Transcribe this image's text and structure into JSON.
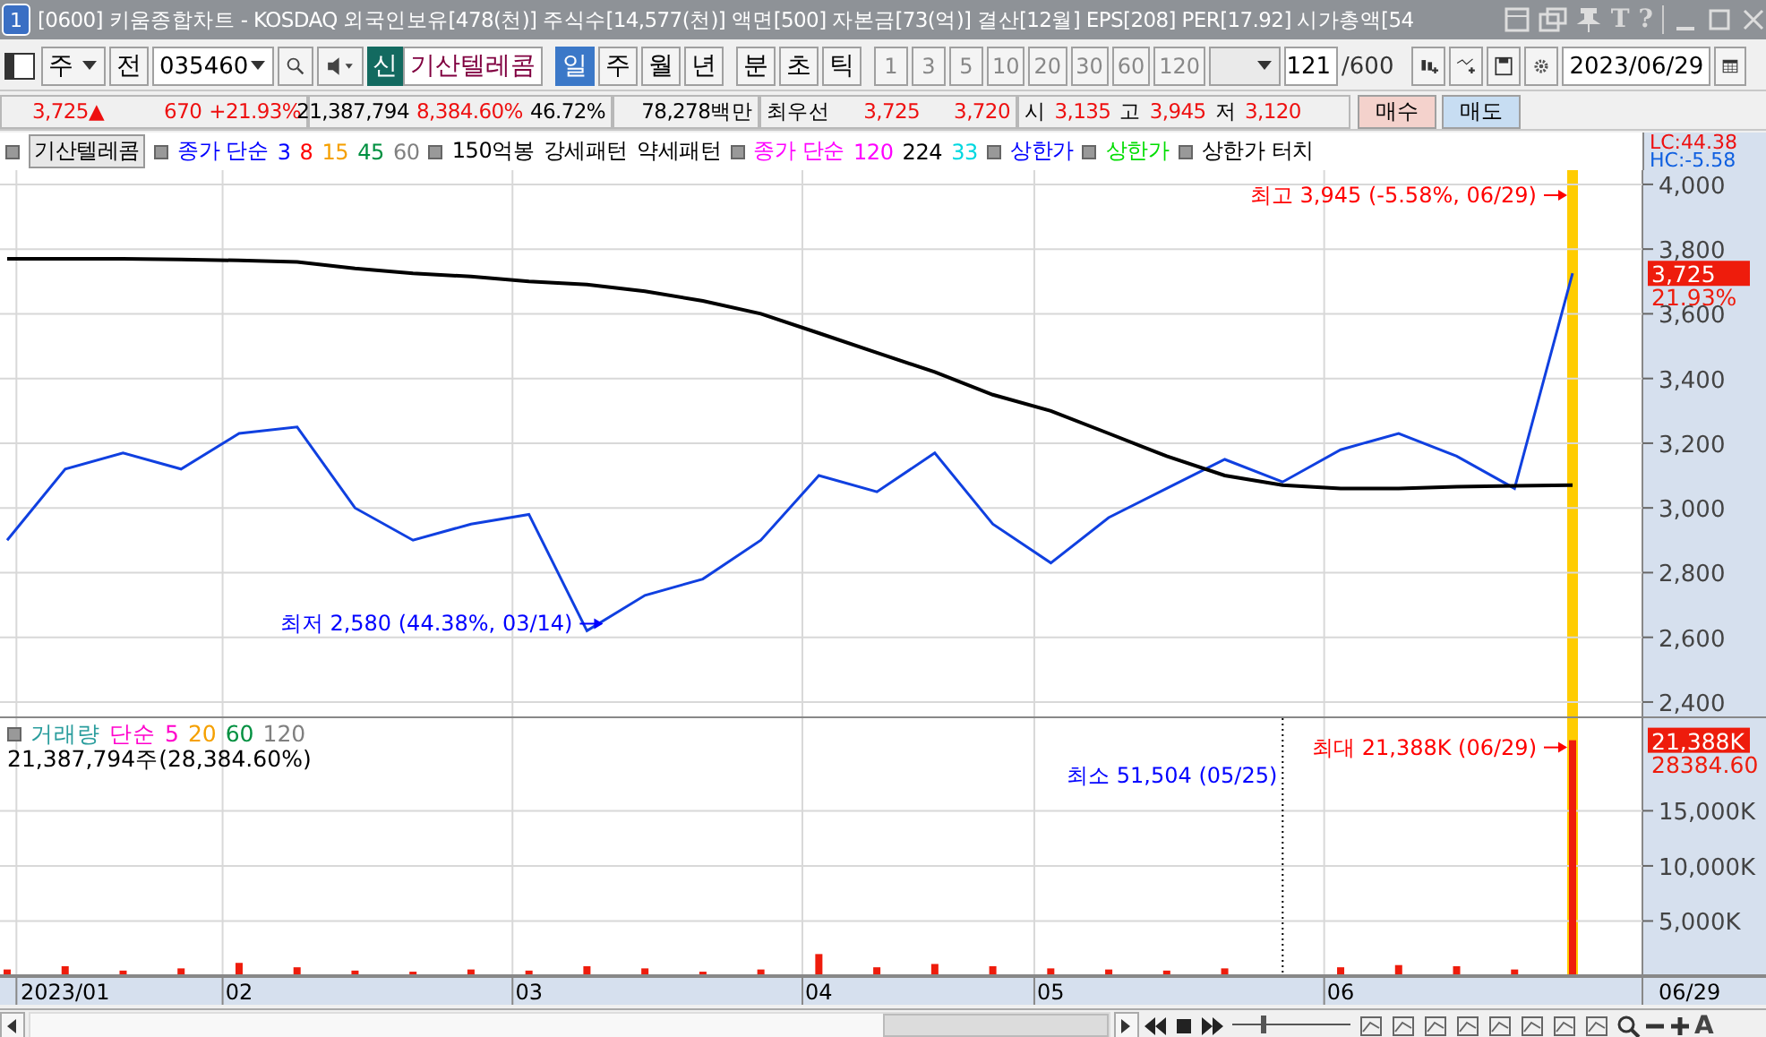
{
  "window": {
    "badge": "1",
    "title": "[0600] 키움종합차트 - KOSDAQ 외국인보유[478(천)] 주식수[14,577(천)] 액면[500] 자본금[73(억)] 결산[12월] EPS[208] PER[17.92] 시가총액[54",
    "glyph_buttons": [
      "T",
      "?"
    ]
  },
  "toolbar": {
    "market": "주",
    "prev_button": "전",
    "code": "035460",
    "new_button": "신",
    "stock_name": "기산텔레콤",
    "periods": [
      {
        "label": "일",
        "selected": true
      },
      {
        "label": "주",
        "selected": false
      },
      {
        "label": "월",
        "selected": false
      },
      {
        "label": "년",
        "selected": false
      }
    ],
    "intervals": [
      {
        "label": "분",
        "selected": false
      },
      {
        "label": "초",
        "selected": false
      },
      {
        "label": "틱",
        "selected": false
      }
    ],
    "interval_values": [
      "1",
      "3",
      "5",
      "10",
      "20",
      "30",
      "60",
      "120"
    ],
    "count": "121",
    "count_max": "/600",
    "date": "2023/06/29"
  },
  "quote": {
    "price": "3,725",
    "arrow": "▲",
    "change": "670",
    "change_rate": "+21.93%",
    "volume": "21,387,794",
    "volume_rate": "8,384.60%",
    "ratio": "46.72%",
    "amount": "78,278백만",
    "best_label": "최우선",
    "best_ask": "3,725",
    "best_bid": "3,720",
    "open_label": "시",
    "open": "3,135",
    "high_label": "고",
    "high": "3,945",
    "low_label": "저",
    "low": "3,120",
    "buy_button": "매수",
    "sell_button": "매도"
  },
  "legend": [
    {
      "kind": "marker"
    },
    {
      "kind": "title",
      "text": "기산텔레콤"
    },
    {
      "kind": "marker"
    },
    {
      "kind": "label",
      "text": "종가 단순",
      "color": "#0000ff"
    },
    {
      "kind": "label",
      "text": "3",
      "color": "#0000ff"
    },
    {
      "kind": "label",
      "text": "8",
      "color": "#ff0000"
    },
    {
      "kind": "label",
      "text": "15",
      "color": "#f5a000"
    },
    {
      "kind": "label",
      "text": "45",
      "color": "#009040"
    },
    {
      "kind": "label",
      "text": "60",
      "color": "#808080"
    },
    {
      "kind": "marker"
    },
    {
      "kind": "label",
      "text": "150억봉",
      "color": "#000000"
    },
    {
      "kind": "label",
      "text": "강세패턴",
      "color": "#000000"
    },
    {
      "kind": "label",
      "text": "약세패턴",
      "color": "#000000"
    },
    {
      "kind": "marker"
    },
    {
      "kind": "label",
      "text": "종가 단순",
      "color": "#ff00ff"
    },
    {
      "kind": "label",
      "text": "120",
      "color": "#ff00ff"
    },
    {
      "kind": "label",
      "text": "224",
      "color": "#000000"
    },
    {
      "kind": "label",
      "text": "33",
      "color": "#00d8e0"
    },
    {
      "kind": "marker"
    },
    {
      "kind": "label",
      "text": "상한가",
      "color": "#0000ff"
    },
    {
      "kind": "marker"
    },
    {
      "kind": "label",
      "text": "상한가",
      "color": "#00dd00"
    },
    {
      "kind": "marker"
    },
    {
      "kind": "label",
      "text": "상한가 터치",
      "color": "#000000"
    }
  ],
  "price_axis_stats": {
    "lc": "LC:44.38",
    "hc": "HC:-5.58"
  },
  "price_tag": {
    "label": "3,725",
    "sublabel": "21.93%"
  },
  "price_chart": {
    "chart_data": {
      "type": "line",
      "categories": [
        null,
        null,
        null,
        null,
        null,
        null,
        null,
        null,
        null,
        null,
        null,
        null,
        null,
        null,
        null,
        null,
        null,
        null,
        null,
        null,
        null,
        null,
        null,
        null,
        null,
        null,
        null,
        null
      ],
      "series": [
        {
          "color": "#1040e0",
          "values": [
            2900,
            3120,
            3170,
            3120,
            3230,
            3250,
            3000,
            2900,
            2950,
            2980,
            2620,
            2730,
            2780,
            2900,
            3100,
            3050,
            3170,
            2950,
            2830,
            2970,
            3060,
            3150,
            3080,
            3180,
            3230,
            3160,
            3060,
            3725
          ]
        },
        {
          "color": "#000000",
          "values": [
            3770,
            3770,
            3770,
            3768,
            3765,
            3760,
            3740,
            3725,
            3715,
            3700,
            3690,
            3670,
            3640,
            3600,
            3540,
            3480,
            3420,
            3350,
            3300,
            3230,
            3160,
            3100,
            3070,
            3060,
            3060,
            3065,
            3068,
            3070
          ]
        }
      ],
      "ylim": [
        2350,
        4044
      ],
      "grid": true,
      "yticks": [
        {
          "value": 2400,
          "label": "2,400"
        },
        {
          "value": 2600,
          "label": "2,600"
        },
        {
          "value": 2800,
          "label": "2,800"
        },
        {
          "value": 3000,
          "label": "3,000"
        },
        {
          "value": 3200,
          "label": "3,200"
        },
        {
          "value": 3400,
          "label": "3,400"
        },
        {
          "value": 3600,
          "label": "3,600"
        },
        {
          "value": 3800,
          "label": "3,800"
        },
        {
          "value": 4000,
          "label": "4,000"
        }
      ],
      "annotations": [
        "최고 3,945 (-5.58%, 06/29)",
        "최저 2,580 (44.38%, 03/14)"
      ]
    }
  },
  "volume_legend": {
    "parts": [
      {
        "text": "거래량",
        "color": "#2a9d9d"
      },
      {
        "text": "단순",
        "color": "#ff00cc"
      },
      {
        "text": "5",
        "color": "#ff00cc"
      },
      {
        "text": "20",
        "color": "#f5a000"
      },
      {
        "text": "60",
        "color": "#009040"
      },
      {
        "text": "120",
        "color": "#808080"
      }
    ],
    "summary": "21,387,794주(28,384.60%)"
  },
  "volume_tag": {
    "label": "21,388K",
    "sublabel": "28384.60"
  },
  "volume_chart": {
    "chart_data": {
      "type": "bar",
      "categories": [
        null,
        "2023/01",
        null,
        null,
        "02",
        null,
        null,
        null,
        null,
        "03",
        null,
        null,
        null,
        null,
        "04",
        null,
        null,
        null,
        "05",
        null,
        null,
        null,
        null,
        "06",
        null,
        null,
        null,
        null
      ],
      "series": [
        {
          "color": "#ee1c0c",
          "values": [
            600,
            900,
            500,
            700,
            1200,
            800,
            500,
            400,
            600,
            500,
            900,
            700,
            400,
            600,
            2000,
            800,
            1100,
            900,
            700,
            600,
            500,
            700,
            null,
            800,
            1000,
            900,
            600,
            21400
          ]
        }
      ],
      "ylim": [
        0,
        23400
      ],
      "grid": true,
      "yticks": [
        {
          "value": 5000,
          "label": "5,000K"
        },
        {
          "value": 10000,
          "label": "10,000K"
        },
        {
          "value": 15000,
          "label": "15,000K"
        }
      ],
      "annotations": [
        "최대 21,388K (06/29)",
        "최소 51,504 (05/25)"
      ]
    }
  },
  "x_axis": {
    "current": "06/29"
  },
  "zoom_slider": {
    "level": 0.25
  },
  "bottom_glyph": "A"
}
